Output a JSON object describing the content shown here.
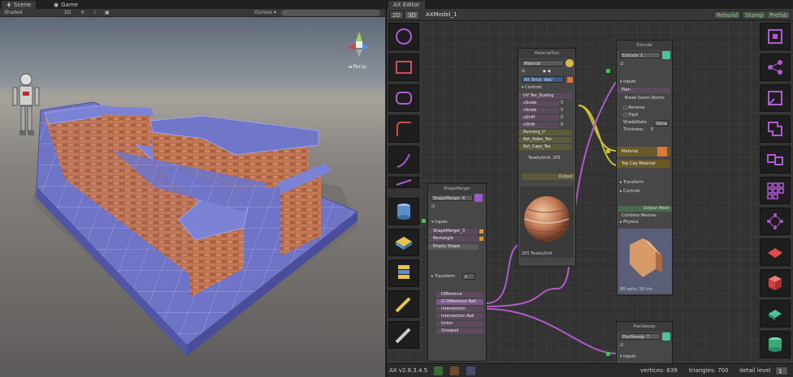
{
  "scene_panel": {
    "tabs": [
      {
        "label": "Scene"
      },
      {
        "label": "Game"
      }
    ],
    "toolbar": {
      "shading": "Shaded",
      "mode_2d": "2D",
      "gizmos": "Gizmos ▾",
      "search_placeholder": "All"
    },
    "persp_label": "Persp"
  },
  "ax_editor": {
    "tab_label": "AX Editor",
    "mode_2d": "2D",
    "mode_3d": "3D",
    "model_name": "AXModel_1",
    "buttons": {
      "rebuild": "Rebuild",
      "stamp": "Stamp",
      "prefab": "Prefab"
    },
    "nodes": {
      "material_tool": {
        "title": "MaterialTool",
        "name_field": "Material",
        "material_field": "AX_Brick_Wall",
        "controls_label": "Controls",
        "params": [
          "UV Tex_Scaling",
          "uScale",
          "vScale",
          "uShift",
          "vShift",
          "Running_U",
          "Rot_Sides_Tex",
          "Rot_Caps_Tex"
        ],
        "values": [
          "",
          "5",
          "5",
          "0",
          "0",
          "",
          "",
          ""
        ],
        "texels_label": "Texels/Unit: 205",
        "output_label": "Output",
        "preview_caption": "205 Texels/Unit"
      },
      "extrude": {
        "title": "Extrude",
        "name_field": "Extrude_1",
        "inputs_label": "Inputs",
        "plan_label": "Plan",
        "break_geom_label": "Break Geom Norms",
        "reverse_label": "Reverse",
        "flip_label": "FlipX",
        "shade_label": "ShadeState",
        "shade_value": "None",
        "thickness_label": "Thickness",
        "thickness_value": "0",
        "material_label": "Material",
        "top_cap_label": "Top Cap Material",
        "transform_label": "Transform",
        "controls_label": "Controls",
        "output_mesh_label": "Output Mesh",
        "combine_label": "Combine Meshes",
        "physics_label": "Physics",
        "verts_caption": "88 verts, 56 tris"
      },
      "shape_merger": {
        "title": "ShapeMerger",
        "name_field": "ShapeMerger_4",
        "inputs_label": "Inputs",
        "input_items": [
          "ShapeMerger_3",
          "Rectangle"
        ],
        "empty_shape_label": "Empty Shape",
        "transform_label": "Transform",
        "outputs": [
          "Difference",
          "Difference Rail",
          "Intersection",
          "Intersection Rail",
          "Union",
          "Grouped"
        ]
      },
      "plan_sweep": {
        "title": "PlanSweep",
        "name_field": "PlanSweep_7",
        "inputs_label": "Inputs"
      }
    },
    "status": {
      "version": "AX v2.8.3.4.5",
      "vertices": "vertices: 639",
      "triangles": "triangles: 700",
      "detail_label": "detail level",
      "detail_value": "1"
    }
  }
}
